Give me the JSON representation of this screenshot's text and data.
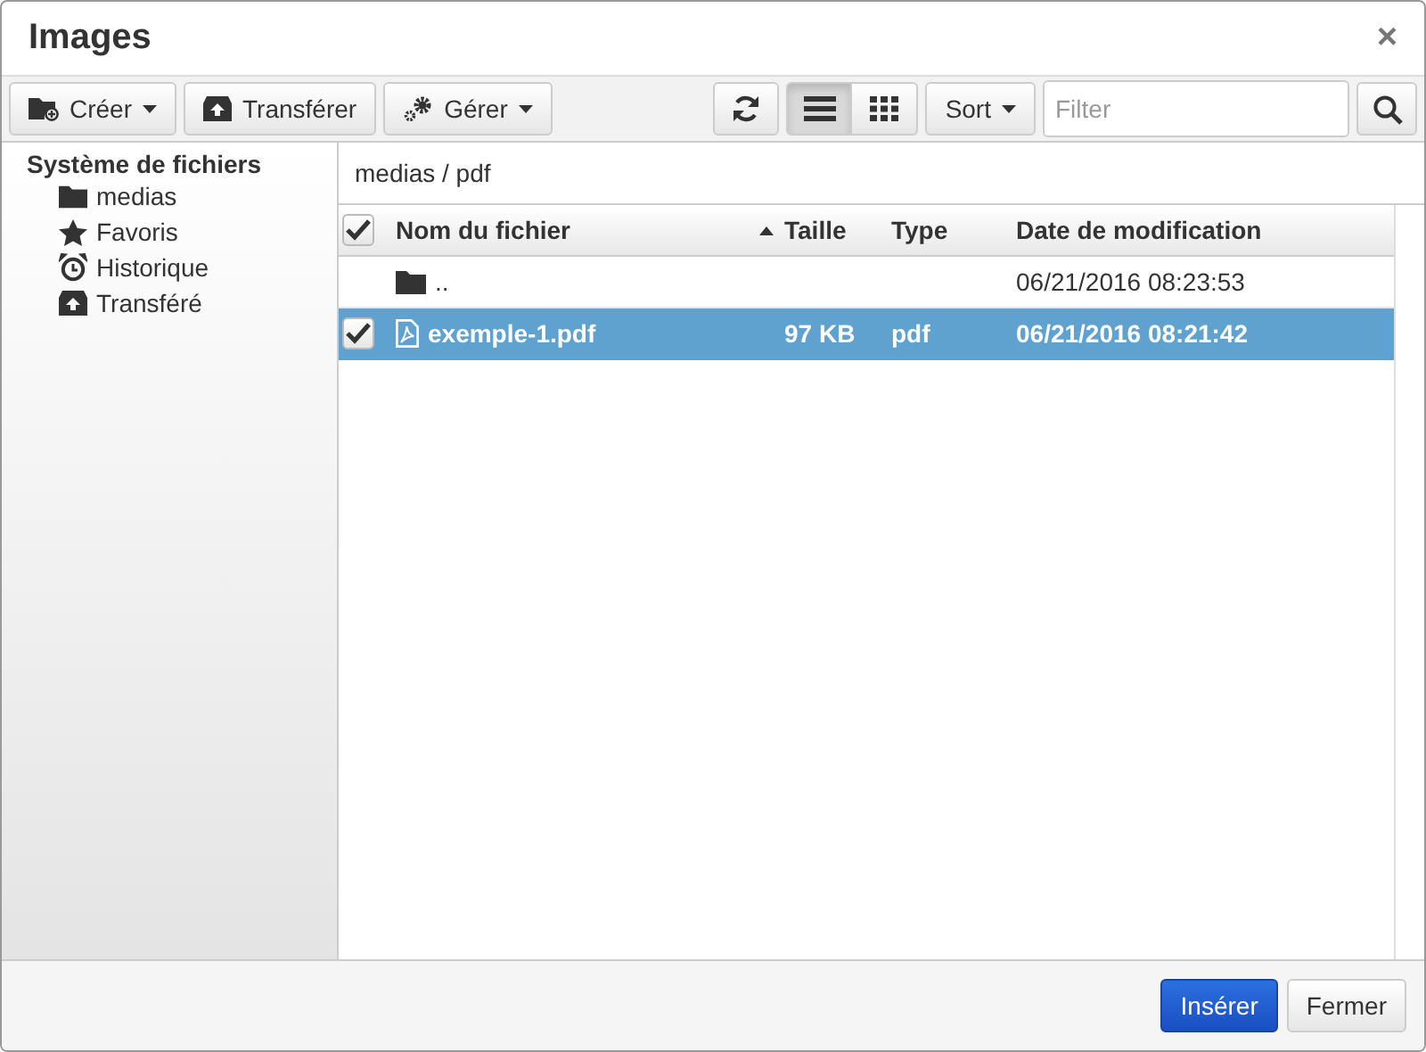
{
  "window": {
    "title": "Images",
    "close": "×"
  },
  "toolbar": {
    "buttons": [
      {
        "label": "Créer",
        "dropdown": true
      },
      {
        "label": "Transférer",
        "dropdown": false
      },
      {
        "label": "Gérer",
        "dropdown": true
      }
    ],
    "views": [
      {
        "selected": true
      },
      {
        "selected": false
      }
    ],
    "sort": {
      "label": "Sort",
      "dropdown": true
    },
    "filter": {
      "placeholder": "Filter"
    }
  },
  "sidebar": {
    "title": "Système de fichiers",
    "items": [
      {
        "label": "medias"
      },
      {
        "label": "Favoris"
      },
      {
        "label": "Historique"
      },
      {
        "label": "Transféré"
      }
    ]
  },
  "breadcrumb": "medias / pdf",
  "table": {
    "all_checked": true,
    "columns": [
      {
        "label": "Nom du fichier",
        "sort_ascending": true
      },
      {
        "label": "Taille"
      },
      {
        "label": "Type"
      },
      {
        "label": "Date de modification"
      }
    ],
    "rows": [
      {
        "kind": "folder",
        "name": "..",
        "date": "06/21/2016 08:23:53",
        "selected": false,
        "checked": false
      },
      {
        "kind": "pdf",
        "name": "exemple-1.pdf",
        "size": "97 KB",
        "type": "pdf",
        "date": "06/21/2016 08:21:42",
        "selected": true,
        "checked": true
      }
    ]
  },
  "footer": {
    "buttons": [
      {
        "label": "Insérer",
        "kind": "primary"
      },
      {
        "label": "Fermer",
        "kind": "default"
      }
    ]
  }
}
